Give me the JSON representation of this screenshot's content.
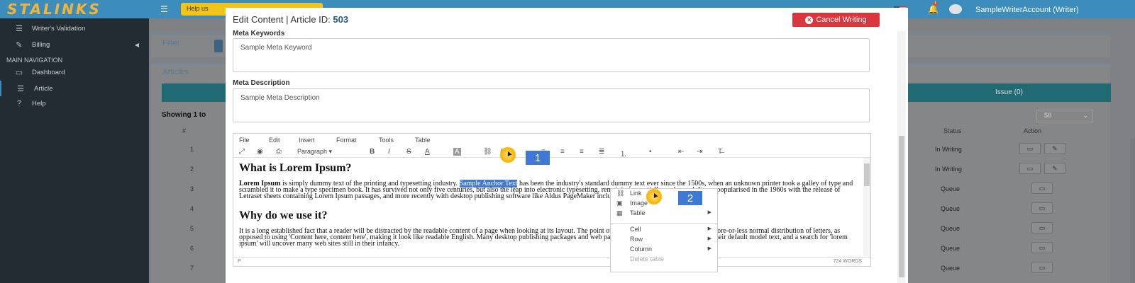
{
  "app": {
    "logo_text": "STALINKS",
    "help_text": "Help us",
    "username": "SampleWriterAccount (Writer)",
    "notification_count": "1"
  },
  "sidebar": {
    "items_top": [
      {
        "label": "Writer's Validation",
        "icon": "check-list-icon"
      },
      {
        "label": "Billing",
        "icon": "pen-icon",
        "arrow": "◀"
      }
    ],
    "section_header": "MAIN NAVIGATION",
    "nav": [
      {
        "label": "Dashboard",
        "icon": "dashboard-icon"
      },
      {
        "label": "Article",
        "icon": "check-list-icon",
        "active": true
      },
      {
        "label": "Help",
        "icon": "question-icon"
      }
    ]
  },
  "background": {
    "filter_title": "Filter",
    "articles_title": "Articles",
    "issue_label": "Issue (0)",
    "showing_text": "Showing 1 to",
    "page_size": "50",
    "columns": {
      "num": "#",
      "status": "Status",
      "action": "Action"
    },
    "rows": [
      {
        "num": "1",
        "status": "In Writing"
      },
      {
        "num": "2",
        "status": "In Writing"
      },
      {
        "num": "3",
        "status": "Queue"
      },
      {
        "num": "4",
        "status": "Queue"
      },
      {
        "num": "5",
        "status": "Queue"
      },
      {
        "num": "6",
        "status": "Queue"
      },
      {
        "num": "7",
        "status": "Queue"
      }
    ]
  },
  "modal": {
    "title_prefix": "Edit Content | Article ID: ",
    "article_id": "503",
    "cancel_label": "Cancel Writing",
    "meta_keywords_label": "Meta Keywords",
    "meta_keywords_value": "Sample Meta Keyword",
    "meta_description_label": "Meta Description",
    "meta_description_value": "Sample Meta Description"
  },
  "editor": {
    "menu": [
      "File",
      "Edit",
      "Insert",
      "Format",
      "Tools",
      "Table"
    ],
    "format_select": "Paragraph",
    "heading1": "What is Lorem Ipsum?",
    "p1_bold": "Lorem Ipsum",
    "p1_before": " is simply dummy text of the printing and typesetting industry. ",
    "p1_selected": "Sample Anchor Text",
    "p1_after": " has been the industry's standard dummy text ever since the 1500s, when an unknown printer took a galley of type and scrambled it to make a type specimen book. It has survived not only five centuries, but also the leap into electronic typesetting, remaining essentially unchanged. It was popularised in the 1960s with the release of Letraset sheets containing Lorem Ipsum passages, and more recently with desktop publishing software like Aldus PageMaker including versions of Lorem Ipsum.",
    "heading2": "Why do we use it?",
    "p2": "It is a long established fact that a reader will be distracted by the readable content of a page when looking at its layout. The point of using Lorem Ipsum is that it has a more-or-less normal distribution of letters, as opposed to using 'Content here, content here', making it look like readable English. Many desktop publishing packages and web page editors now use Lorem Ipsum as their default model text, and a search for 'lorem ipsum' will uncover many web sites still in their infancy.",
    "status_path": "P",
    "word_count": "724 WORDS"
  },
  "context_menu": {
    "items": [
      {
        "label": "Link",
        "icon": "link-icon"
      },
      {
        "label": "Image",
        "icon": "image-icon"
      },
      {
        "label": "Table",
        "icon": "table-icon",
        "submenu": true
      },
      {
        "label": "Cell",
        "submenu": true
      },
      {
        "label": "Row",
        "submenu": true
      },
      {
        "label": "Column",
        "submenu": true
      },
      {
        "label": "Delete table",
        "disabled": true
      }
    ]
  },
  "steps": {
    "one": "1",
    "two": "2"
  },
  "colors": {
    "header_blue": "#3c8dbc",
    "sidebar_dark": "#232c33",
    "logo_orange": "#f7b334",
    "cancel_red": "#d9363e",
    "selection_blue": "#3f79d6"
  }
}
